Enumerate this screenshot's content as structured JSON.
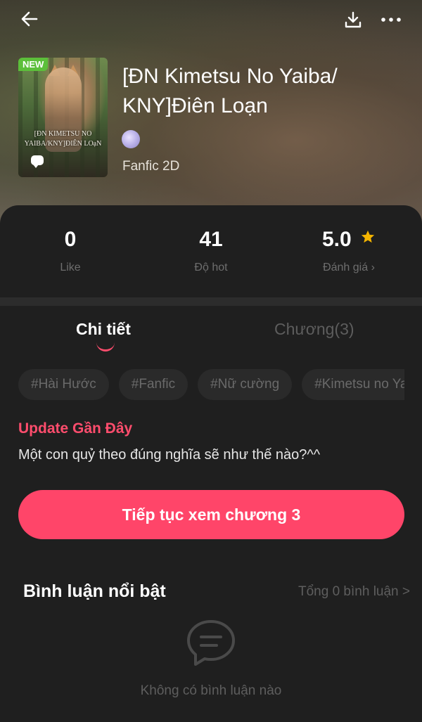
{
  "topbar": {
    "back_icon": "arrow-left-icon",
    "download_icon": "download-icon",
    "more_icon": "more-horizontal-icon"
  },
  "book": {
    "badge": "NEW",
    "cover_text": "[ĐN KIMETSU NO YAIBA/KNY]ĐIÊN LOạN",
    "title": "[ĐN Kimetsu No Yaiba/ KNY]Điên Loạn",
    "genre": "Fanfic 2D"
  },
  "stats": [
    {
      "value": "0",
      "label": "Like"
    },
    {
      "value": "41",
      "label": "Độ hot"
    },
    {
      "value": "5.0",
      "label": "Đánh giá ›"
    }
  ],
  "tabs": {
    "details": "Chi tiết",
    "chapters": "Chương(3)"
  },
  "tags": [
    "#Hài Hước",
    "#Fanfic",
    "#Nữ cường",
    "#Kimetsu no Yaiba"
  ],
  "update": {
    "title": "Update Gần Đây",
    "text": "Một con quỷ theo đúng nghĩa sẽ như thế nào?^^"
  },
  "cta_label": "Tiếp tục xem chương 3",
  "comments": {
    "title": "Bình luận nổi bật",
    "total": "Tổng 0 bình luận >",
    "empty": "Không có bình luận nào"
  },
  "colors": {
    "accent": "#ff4569",
    "badge_green": "#5cbf3a",
    "star": "#f4b400",
    "background": "#1f1f1f"
  }
}
